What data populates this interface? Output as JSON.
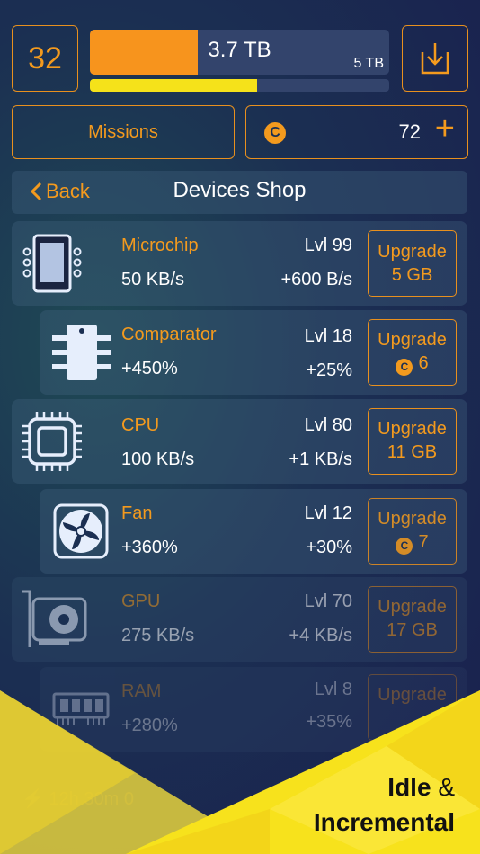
{
  "player": {
    "level": "32"
  },
  "storage": {
    "current": "3.7 TB",
    "max": "5 TB",
    "fill_fraction": 0.36,
    "progress_fraction": 0.56
  },
  "buttons": {
    "missions": "Missions",
    "save_icon": "download-tray-icon"
  },
  "coins": {
    "amount": "72",
    "plus": "+",
    "icon_letter": "C"
  },
  "shop": {
    "back": "Back",
    "title": "Devices Shop"
  },
  "devices": [
    {
      "name": "Microchip",
      "rate": "50 KB/s",
      "level": "Lvl 99",
      "bonus": "+600 B/s",
      "upgrade": "Upgrade",
      "cost": "5 GB",
      "icon": "microchip-icon"
    },
    {
      "name": "Comparator",
      "rate": "+450%",
      "level": "Lvl 18",
      "bonus": "+25%",
      "upgrade": "Upgrade",
      "cost": "6",
      "icon": "comparator-chip-icon"
    },
    {
      "name": "CPU",
      "rate": "100 KB/s",
      "level": "Lvl 80",
      "bonus": "+1 KB/s",
      "upgrade": "Upgrade",
      "cost": "11 GB",
      "icon": "cpu-icon"
    },
    {
      "name": "Fan",
      "rate": "+360%",
      "level": "Lvl 12",
      "bonus": "+30%",
      "upgrade": "Upgrade",
      "cost": "7",
      "icon": "fan-icon"
    },
    {
      "name": "GPU",
      "rate": "275 KB/s",
      "level": "Lvl 70",
      "bonus": "+4 KB/s",
      "upgrade": "Upgrade",
      "cost": "17 GB",
      "icon": "gpu-icon"
    },
    {
      "name": "RAM",
      "rate": "+280%",
      "level": "Lvl 8",
      "bonus": "+35%",
      "upgrade": "Upgrade",
      "cost": "",
      "icon": "ram-icon"
    }
  ],
  "timer": {
    "text": "12h 30m 0"
  },
  "tagline": {
    "line1": "Idle",
    "amp": "&",
    "line2": "Incremental"
  },
  "colors": {
    "accent": "#f39a1e",
    "yellow": "#f5e21a",
    "bg": "#1b2f52"
  }
}
